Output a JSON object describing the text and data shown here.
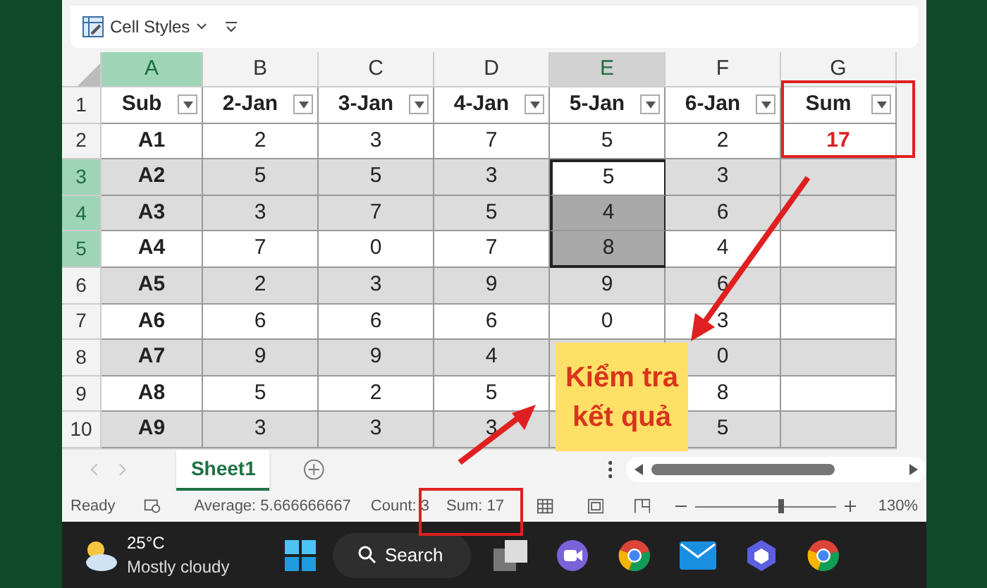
{
  "ribbon": {
    "cell_styles": "Cell Styles"
  },
  "columns": [
    {
      "label": "A",
      "kind": "label",
      "active": true,
      "selected": false
    },
    {
      "label": "B",
      "kind": "number",
      "active": false,
      "selected": false
    },
    {
      "label": "C",
      "kind": "number",
      "active": false,
      "selected": false
    },
    {
      "label": "D",
      "kind": "number",
      "active": false,
      "selected": false
    },
    {
      "label": "E",
      "kind": "number",
      "active": false,
      "selected": true
    },
    {
      "label": "F",
      "kind": "number",
      "active": false,
      "selected": false
    },
    {
      "label": "G",
      "kind": "total",
      "active": false,
      "selected": false
    }
  ],
  "rows": [
    {
      "number": "1",
      "kind": "header",
      "banded": false,
      "selected": false,
      "cells": [
        {
          "text": "Sub",
          "selected": false
        },
        {
          "text": "2-Jan",
          "selected": false
        },
        {
          "text": "3-Jan",
          "selected": false
        },
        {
          "text": "4-Jan",
          "selected": false
        },
        {
          "text": "5-Jan",
          "selected": false
        },
        {
          "text": "6-Jan",
          "selected": false
        },
        {
          "text": "Sum",
          "selected": false
        }
      ]
    },
    {
      "number": "2",
      "kind": "data",
      "banded": false,
      "selected": false,
      "cells": [
        {
          "text": "A1",
          "selected": false
        },
        {
          "text": "2",
          "selected": false
        },
        {
          "text": "3",
          "selected": false
        },
        {
          "text": "7",
          "selected": false
        },
        {
          "text": "5",
          "selected": false
        },
        {
          "text": "2",
          "selected": false
        },
        {
          "text": "17",
          "selected": false
        }
      ]
    },
    {
      "number": "3",
      "kind": "data",
      "banded": true,
      "selected": true,
      "cells": [
        {
          "text": "A2",
          "selected": false
        },
        {
          "text": "5",
          "selected": false
        },
        {
          "text": "5",
          "selected": false
        },
        {
          "text": "3",
          "selected": false
        },
        {
          "text": "5",
          "selected": true
        },
        {
          "text": "3",
          "selected": false
        },
        {
          "selected": false
        }
      ]
    },
    {
      "number": "4",
      "kind": "data",
      "banded": true,
      "selected": true,
      "cells": [
        {
          "text": "A3",
          "selected": false
        },
        {
          "text": "3",
          "selected": false
        },
        {
          "text": "7",
          "selected": false
        },
        {
          "text": "5",
          "selected": false
        },
        {
          "text": "4",
          "selected": true
        },
        {
          "text": "6",
          "selected": false
        },
        {
          "selected": false
        }
      ]
    },
    {
      "number": "5",
      "kind": "data",
      "banded": false,
      "selected": true,
      "cells": [
        {
          "text": "A4",
          "selected": false
        },
        {
          "text": "7",
          "selected": false
        },
        {
          "text": "0",
          "selected": false
        },
        {
          "text": "7",
          "selected": false
        },
        {
          "text": "8",
          "selected": true
        },
        {
          "text": "4",
          "selected": false
        },
        {
          "selected": false
        }
      ]
    },
    {
      "number": "6",
      "kind": "data",
      "banded": true,
      "selected": false,
      "cells": [
        {
          "text": "A5",
          "selected": false
        },
        {
          "text": "2",
          "selected": false
        },
        {
          "text": "3",
          "selected": false
        },
        {
          "text": "9",
          "selected": false
        },
        {
          "text": "9",
          "selected": false
        },
        {
          "text": "6",
          "selected": false
        },
        {
          "selected": false
        }
      ]
    },
    {
      "number": "7",
      "kind": "data",
      "banded": false,
      "selected": false,
      "cells": [
        {
          "text": "A6",
          "selected": false
        },
        {
          "text": "6",
          "selected": false
        },
        {
          "text": "6",
          "selected": false
        },
        {
          "text": "6",
          "selected": false
        },
        {
          "text": "0",
          "selected": false
        },
        {
          "text": "3",
          "selected": false
        },
        {
          "selected": false
        }
      ]
    },
    {
      "number": "8",
      "kind": "data",
      "banded": true,
      "selected": false,
      "cells": [
        {
          "text": "A7",
          "selected": false
        },
        {
          "text": "9",
          "selected": false
        },
        {
          "text": "9",
          "selected": false
        },
        {
          "text": "4",
          "selected": false
        },
        {
          "selected": false
        },
        {
          "text": "0",
          "selected": false
        },
        {
          "selected": false
        }
      ]
    },
    {
      "number": "9",
      "kind": "data",
      "banded": false,
      "selected": false,
      "cells": [
        {
          "text": "A8",
          "selected": false
        },
        {
          "text": "5",
          "selected": false
        },
        {
          "text": "2",
          "selected": false
        },
        {
          "text": "5",
          "selected": false
        },
        {
          "selected": false
        },
        {
          "text": "8",
          "selected": false
        },
        {
          "selected": false
        }
      ]
    },
    {
      "number": "10",
      "kind": "data",
      "banded": true,
      "selected": false,
      "cells": [
        {
          "text": "A9",
          "selected": false
        },
        {
          "text": "3",
          "selected": false
        },
        {
          "text": "3",
          "selected": false
        },
        {
          "text": "3",
          "selected": false
        },
        {
          "selected": false
        },
        {
          "text": "5",
          "selected": false
        },
        {
          "selected": false
        }
      ]
    }
  ],
  "sheet_tabs": [
    {
      "label": "Sheet1",
      "selected": true
    }
  ],
  "status_bar": {
    "mode": "Ready",
    "average": "Average: 5.666666667",
    "count": "Count: 3",
    "sum": "Sum: 17",
    "zoom_slider": {
      "level": 0.62
    },
    "zoom": "130%"
  },
  "callout": {
    "text": "Kiểm tra kết quả"
  },
  "taskbar": {
    "temperature": "25°C",
    "weather": "Mostly cloudy",
    "search": "Search"
  }
}
